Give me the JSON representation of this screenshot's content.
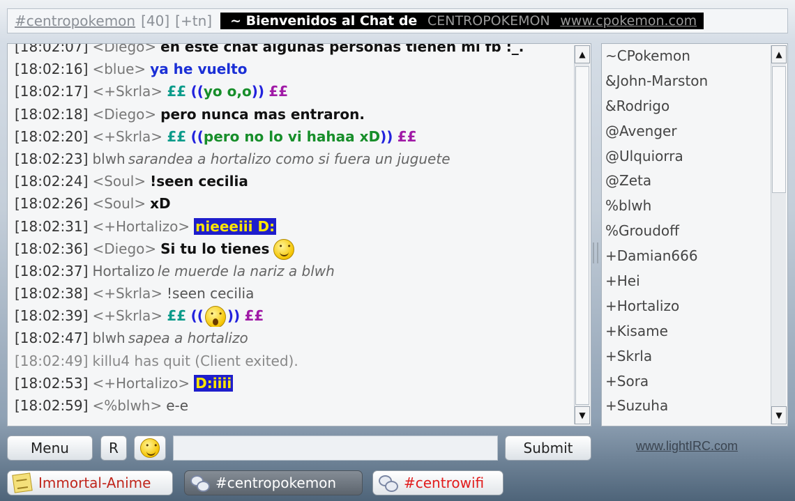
{
  "header": {
    "channel": "#centropokemon",
    "user_count": "[40]",
    "modes": "[+tn]",
    "topic_prefix": "~ Bienvenidos al Chat de",
    "topic_site": "CENTROPOKEMON",
    "topic_url": "www.cpokemon.com"
  },
  "messages": [
    {
      "ts": "[18:02:07]",
      "nick": "<Diego>",
      "text": "en este chat algunas personas tienen mi fb :_."
    },
    {
      "ts": "[18:02:16]",
      "nick": "<blue>",
      "text": "ya he vuelto"
    },
    {
      "ts": "[18:02:17]",
      "nick": "<+Skrla>",
      "p1": "££",
      "p2": "((",
      "p3": "yo o,o",
      "p4": "))",
      "p5": "££"
    },
    {
      "ts": "[18:02:18]",
      "nick": "<Diego>",
      "text": "pero nunca mas entraron."
    },
    {
      "ts": "[18:02:20]",
      "nick": "<+Skrla>",
      "p1": "££",
      "p2": "((",
      "p3": "pero no lo vi hahaa xD",
      "p4": "))",
      "p5": "££"
    },
    {
      "ts": "[18:02:23]",
      "actor": "blwh",
      "action": "sarandea a hortalizo como si fuera un juguete"
    },
    {
      "ts": "[18:02:24]",
      "nick": "<Soul>",
      "text": "!seen cecilia"
    },
    {
      "ts": "[18:02:26]",
      "nick": "<Soul>",
      "text": "xD"
    },
    {
      "ts": "[18:02:31]",
      "nick": "<+Hortalizo>",
      "text": "nieeeiii D:"
    },
    {
      "ts": "[18:02:36]",
      "nick": "<Diego>",
      "text": "Si tu lo tienes"
    },
    {
      "ts": "[18:02:37]",
      "actor": "Hortalizo",
      "action": "le muerde la nariz a blwh"
    },
    {
      "ts": "[18:02:38]",
      "nick": "<+Skrla>",
      "text": "!seen cecilia"
    },
    {
      "ts": "[18:02:39]",
      "nick": "<+Skrla>",
      "p1": "££",
      "p2": "((",
      "p4": "))",
      "p5": "££"
    },
    {
      "ts": "[18:02:47]",
      "actor": "blwh",
      "action": "sapea a hortalizo"
    },
    {
      "ts": "[18:02:49]",
      "text": "killu4 has quit (Client exited)."
    },
    {
      "ts": "[18:02:53]",
      "nick": "<+Hortalizo>",
      "text": "D:iiii"
    },
    {
      "ts": "[18:02:59]",
      "nick": "<%blwh>",
      "text": "e-e"
    }
  ],
  "users": [
    "~CPokemon",
    "&John-Marston",
    "&Rodrigo",
    "@Avenger",
    "@Ulquiorra",
    "@Zeta",
    "%blwh",
    "%Groudoff",
    "+Damian666",
    "+Hei",
    "+Hortalizo",
    "+Kisame",
    "+Skrla",
    "+Sora",
    "+Suzuha"
  ],
  "footer": {
    "menu_label": "Menu",
    "r_label": "R",
    "submit_label": "Submit",
    "input_value": "",
    "brand": "www.lightIRC.com"
  },
  "tabs": [
    "Immortal-Anime",
    "#centropokemon",
    "#centrowifi"
  ],
  "colors": {
    "highlight_bg": "#1e1ecc",
    "highlight_fg": "#ffe600",
    "active_tab": "#5c646d",
    "tab_text_red": "#e11b1b"
  }
}
